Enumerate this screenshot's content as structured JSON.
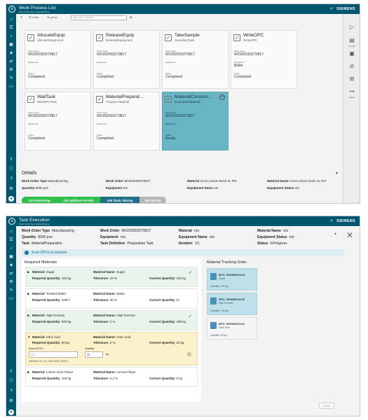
{
  "w1": {
    "title": "Work Process List",
    "subtitle": "Work Order Type: Manufacturing",
    "brand": "SIEMENS",
    "toolbar": {
      "mode": "mode",
      "group": "group",
      "search_placeholder": "type here to search"
    },
    "cards": [
      {
        "title": "AllocateEquip",
        "sub": "AllocateEquipment",
        "wo_label": "Work Order",
        "wo": "WO202003270817",
        "eq_label": "Equipment",
        "eq": "",
        "st_label": "Status",
        "st": "Completed"
      },
      {
        "title": "ReleaseEquip",
        "sub": "ReleaseEquipment",
        "wo_label": "Work Order",
        "wo": "WO202003270817",
        "eq_label": "Equipment",
        "eq": "",
        "st_label": "Status",
        "st": "Completed"
      },
      {
        "title": "TakeSample",
        "sub": "SamplingTask",
        "wo_label": "Work Order",
        "wo": "WO202003270817",
        "eq_label": "Equipment",
        "eq": "",
        "st_label": "Status",
        "st": "Completed"
      },
      {
        "title": "WriteOPC",
        "sub": "WriteOPC",
        "wo_label": "Work Order",
        "wo": "WO202003270817",
        "eq_label": "Equipment",
        "eq": "Boiler",
        "st_label": "Status",
        "st": "Completed"
      },
      {
        "title": "WaitTask",
        "sub": "WaitOPCTask",
        "wo_label": "Work Order",
        "wo": "WO202003270817",
        "eq_label": "Equipment",
        "eq": "",
        "st_label": "Status",
        "st": "Completed"
      },
      {
        "title": "MaterialPreparat...",
        "sub": "Prepare Material",
        "wo_label": "Work Order",
        "wo": "WO202003270817",
        "eq_label": "Equipment",
        "eq": "",
        "st_label": "Status",
        "st": "Completed"
      },
      {
        "title": "MaterialConsum...",
        "sub": "Consume Material",
        "wo_label": "Work Order",
        "wo": "WO202003270817",
        "eq_label": "Equipment",
        "eq": "",
        "st_label": "Status",
        "st": "Ready"
      }
    ],
    "details": {
      "heading": "Details",
      "wot_label": "Work Order Type",
      "wot": "Manufacturing",
      "wo_label": "Work Order",
      "wo": "WO202003270817",
      "mat_label": "Material",
      "mat": "Acme Lemon Rush 2L Pet",
      "mname_label": "Material Name",
      "mname": "Acme Lemon Rush 2L Pet",
      "qty_label": "Quantity",
      "qty": "8000 pce",
      "eq_label": "Equipment",
      "eq": "n/a",
      "eqn_label": "Equipment Name",
      "eqn": "n/a",
      "eqs_label": "Equipment Status",
      "eqs": "n/a"
    },
    "steps": [
      "110 Dissolving",
      "120 Additive Pre-Mix",
      "150 Static Mixing",
      "200 Mixing"
    ],
    "right_labels": [
      "Details",
      "Status"
    ]
  },
  "w2": {
    "title": "Task Execution",
    "subtitle": "Work Order Type: Manufacturing",
    "brand": "SIEMENS",
    "header": {
      "wot_label": "Work Order Type",
      "wot": "Manufacturing",
      "wo_label": "Work Order",
      "wo": "WO202003270817",
      "mat_label": "Material",
      "mat": "n/a",
      "mname_label": "Material Name",
      "mname": "n/a",
      "qty_label": "Quantity",
      "qty": "8000 pce",
      "eq_label": "Equipment",
      "eq": "n/a",
      "eqn_label": "Equipment Name",
      "eqn": "n/a",
      "eqs_label": "Equipment Status",
      "eqs": "n/a",
      "task_label": "Task",
      "task": "MaterialPreparation",
      "tdesc_label": "Task Definition",
      "tdesc": "Preparation Task",
      "iter_label": "Iteration",
      "iter": "1/1",
      "status_label": "Status",
      "status": "InProgress"
    },
    "scan_text": "Scan MTUs to prepare",
    "required_heading": "Required Materials",
    "tracking_heading": "Material Tracking Units:",
    "labels": {
      "material": "Material:",
      "material_name": "Material Name:",
      "required_qty": "Required Quantity:",
      "tolerance": "Tolerance:",
      "current_qty": "Current Quantity:",
      "source_mtu": "Source MTU:",
      "quantity": "Quantity:"
    },
    "materials": [
      {
        "mat": "Sugar",
        "name": "Sugar",
        "req": "150 kg",
        "tol": "10 %",
        "cur": "150 kg"
      },
      {
        "mat": "Treated Water",
        "name": "Water",
        "req": "1000 l",
        "tol": "20 %",
        "cur": "0 l"
      },
      {
        "mat": "High fructose",
        "name": "High fructose",
        "req": "500 kg",
        "tol": "3 %",
        "cur": "498 kg"
      },
      {
        "mat": "Citric Acid",
        "name": "Citric Acid",
        "req": "50 kg",
        "tol": "5 %",
        "cur": "25 kg"
      },
      {
        "mat": "Lemon Lime Flavor",
        "name": "Lemon Flavor",
        "req": "150 kg",
        "tol": "0.2 %",
        "cur": "0 kg"
      }
    ],
    "active_inputs": {
      "source_placeholder": "n/a",
      "qty_value": "25",
      "unit": "kg",
      "lot": "Material Lot: Lot_Citric Acid_000001"
    },
    "mtus": [
      {
        "id": "MTU_000000011118",
        "mat": "Sugar",
        "qty": "Quantity: 150 kg"
      },
      {
        "id": "MTU_000000011120",
        "mat": "High fructose",
        "qty": "Quantity: 498 kg"
      },
      {
        "id": "MTU_000000011121",
        "mat": "Citric Acid",
        "qty": "Quantity: 25 kg"
      }
    ],
    "done": "Done"
  },
  "colors": {
    "teal": "#00566f",
    "selected_card": "#6ab5c5",
    "step_green": "#2fbf4b",
    "step_teal": "#1f6f89",
    "step_grey": "#b6b6b6",
    "active_row": "#fbf1cb",
    "done_row": "#e8f4ec"
  }
}
